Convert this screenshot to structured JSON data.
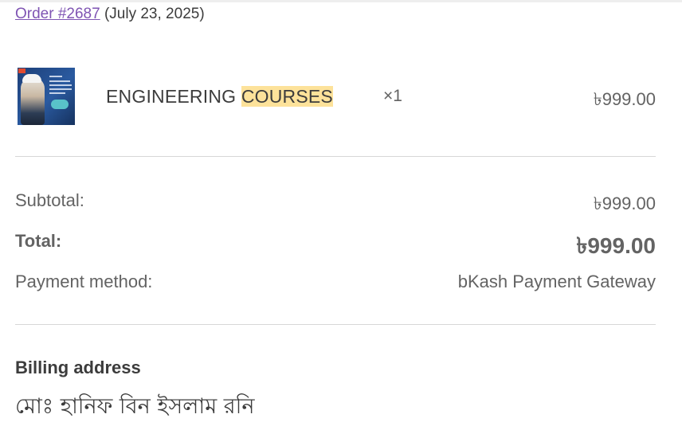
{
  "order": {
    "number_label": "Order #2687",
    "date": "(July 23, 2025)"
  },
  "item": {
    "name_part1": "ENGINEERING",
    "name_highlight": "COURSES",
    "quantity": "×1",
    "price": "৳999.00"
  },
  "totals": {
    "subtotal_label": "Subtotal:",
    "subtotal_value": "৳999.00",
    "total_label": "Total:",
    "total_value": "৳999.00",
    "payment_label": "Payment method:",
    "payment_value": "bKash Payment Gateway"
  },
  "billing": {
    "title": "Billing address",
    "name": "মোঃ হানিফ বিন ইসলাম রনি"
  },
  "colors": {
    "link": "#7f54b3",
    "highlight": "#fde29a"
  }
}
